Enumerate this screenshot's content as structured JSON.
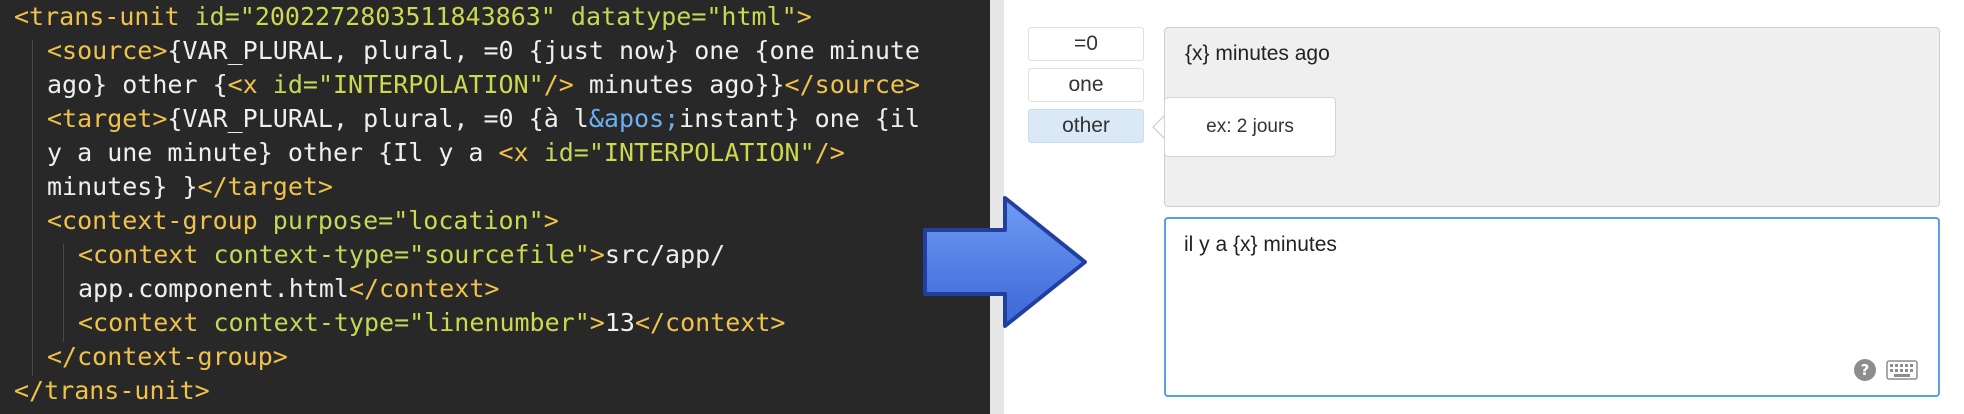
{
  "code": {
    "line1": {
      "open": "<trans-unit ",
      "a1": "id=",
      "v1": "\"2002272803511843863\"",
      "a2": " datatype=",
      "v2": "\"html\"",
      "close": ">"
    },
    "line2": {
      "open": "<source>",
      "text": "{VAR_PLURAL, plural, =0 {just now} one {one minute"
    },
    "line3": {
      "text1": "ago} other {",
      "open": "<x ",
      "attr": "id=",
      "val": "\"INTERPOLATION\"",
      "selfclose": "/>",
      "text2": " minutes ago}}",
      "close": "</source>"
    },
    "line4": {
      "open": "<target>",
      "text1": "{VAR_PLURAL, plural, =0 {à l",
      "entity": "&apos;",
      "text2": "instant} one {il"
    },
    "line5": {
      "text1": "y a une minute} other {Il y a ",
      "open": "<x ",
      "attr": "id=",
      "val": "\"INTERPOLATION\"",
      "selfclose": "/>"
    },
    "line6": {
      "text": "minutes} }",
      "close": "</target>"
    },
    "line7": {
      "open": "<context-group ",
      "attr": "purpose=",
      "val": "\"location\"",
      "close": ">"
    },
    "line8": {
      "open": "<context ",
      "attr": "context-type=",
      "val": "\"sourcefile\"",
      "close": ">",
      "text": "src/app/"
    },
    "line9": {
      "text": "app.component.html",
      "close": "</context>"
    },
    "line10": {
      "open": "<context ",
      "attr": "context-type=",
      "val": "\"linenumber\"",
      "close": ">",
      "text": "13",
      "end": "</context>"
    },
    "line11": {
      "close": "</context-group>"
    },
    "line12": {
      "close": "</trans-unit>"
    }
  },
  "editor": {
    "cases": [
      "=0",
      "one",
      "other"
    ],
    "active_case": "other",
    "source_text": "{x} minutes ago",
    "tooltip": "ex: 2 jours",
    "target_text": "il y a {x} minutes"
  },
  "colors": {
    "code_bg": "#282828",
    "tag": "#f0c24b",
    "attr": "#c2d858",
    "entity": "#6ab0f3",
    "arrow": "#4f7fe8",
    "focus_border": "#5aa0e0",
    "active_case_bg": "#dbe9f7"
  },
  "icons": [
    "arrow-right-icon",
    "help-icon",
    "keyboard-icon"
  ]
}
